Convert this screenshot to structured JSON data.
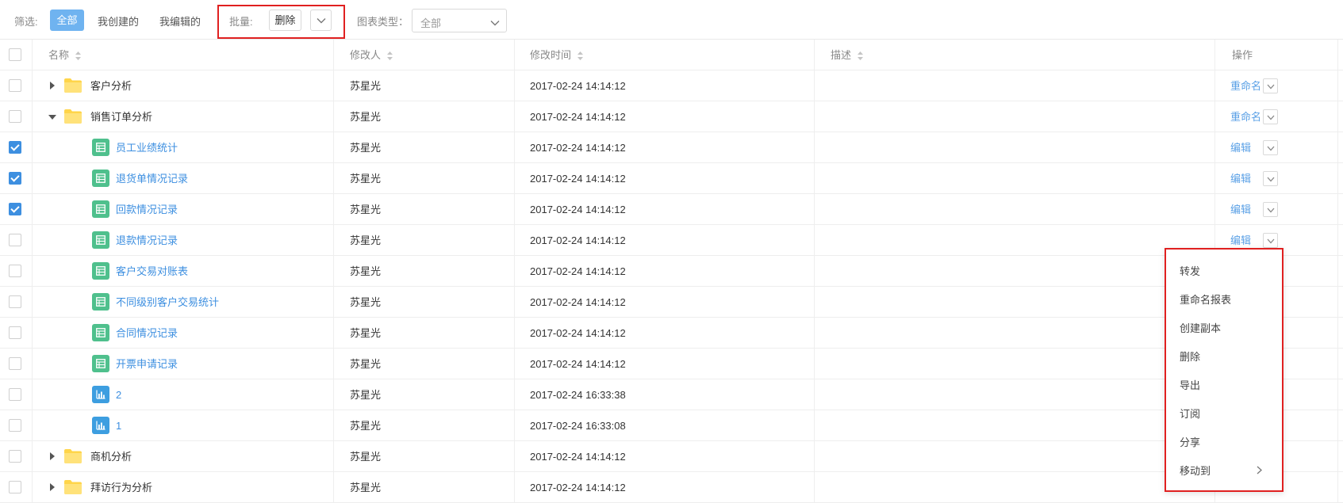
{
  "toolbar": {
    "filter_label": "筛选:",
    "filter_all": "全部",
    "filter_mine": "我创建的",
    "filter_edited": "我编辑的",
    "batch_label": "批量:",
    "batch_delete": "删除",
    "chart_type_label": "图表类型：",
    "chart_type_value": "全部"
  },
  "table": {
    "headers": {
      "name": "名称",
      "modifier": "修改人",
      "modified_time": "修改时间",
      "description": "描述",
      "operation": "操作"
    },
    "rows": [
      {
        "kind": "folder",
        "state": "collapsed",
        "checked": false,
        "name": "客户分析",
        "modifier": "苏星光",
        "time": "2017-02-24 14:14:12",
        "op": "重命名"
      },
      {
        "kind": "folder",
        "state": "expanded",
        "checked": false,
        "name": "销售订单分析",
        "modifier": "苏星光",
        "time": "2017-02-24 14:14:12",
        "op": "重命名"
      },
      {
        "kind": "table",
        "checked": true,
        "name": "员工业绩统计",
        "modifier": "苏星光",
        "time": "2017-02-24 14:14:12",
        "op": "编辑"
      },
      {
        "kind": "table",
        "checked": true,
        "name": "退货单情况记录",
        "modifier": "苏星光",
        "time": "2017-02-24 14:14:12",
        "op": "编辑"
      },
      {
        "kind": "table",
        "checked": true,
        "name": "回款情况记录",
        "modifier": "苏星光",
        "time": "2017-02-24 14:14:12",
        "op": "编辑"
      },
      {
        "kind": "table",
        "checked": false,
        "name": "退款情况记录",
        "modifier": "苏星光",
        "time": "2017-02-24 14:14:12",
        "op": "编辑"
      },
      {
        "kind": "table",
        "checked": false,
        "name": "客户交易对账表",
        "modifier": "苏星光",
        "time": "2017-02-24 14:14:12",
        "op": ""
      },
      {
        "kind": "table",
        "checked": false,
        "name": "不同级别客户交易统计",
        "modifier": "苏星光",
        "time": "2017-02-24 14:14:12",
        "op": ""
      },
      {
        "kind": "table",
        "checked": false,
        "name": "合同情况记录",
        "modifier": "苏星光",
        "time": "2017-02-24 14:14:12",
        "op": ""
      },
      {
        "kind": "table",
        "checked": false,
        "name": "开票申请记录",
        "modifier": "苏星光",
        "time": "2017-02-24 14:14:12",
        "op": ""
      },
      {
        "kind": "chart",
        "checked": false,
        "name": "2",
        "modifier": "苏星光",
        "time": "2017-02-24 16:33:38",
        "op": ""
      },
      {
        "kind": "chart",
        "checked": false,
        "name": "1",
        "modifier": "苏星光",
        "time": "2017-02-24 16:33:08",
        "op": ""
      },
      {
        "kind": "folder",
        "state": "collapsed",
        "checked": false,
        "name": "商机分析",
        "modifier": "苏星光",
        "time": "2017-02-24 14:14:12",
        "op": ""
      },
      {
        "kind": "folder",
        "state": "collapsed",
        "checked": false,
        "name": "拜访行为分析",
        "modifier": "苏星光",
        "time": "2017-02-24 14:14:12",
        "op": ""
      }
    ]
  },
  "context_menu": {
    "items": [
      "转发",
      "重命名报表",
      "创建副本",
      "删除",
      "导出",
      "订阅",
      "分享",
      "移动到"
    ]
  },
  "colors": {
    "accent": "#3d8fe0",
    "highlight_box": "#e02020",
    "table_icon": "#4fc08d",
    "chart_icon": "#3d9ee0",
    "folder": "#ffd54a"
  }
}
